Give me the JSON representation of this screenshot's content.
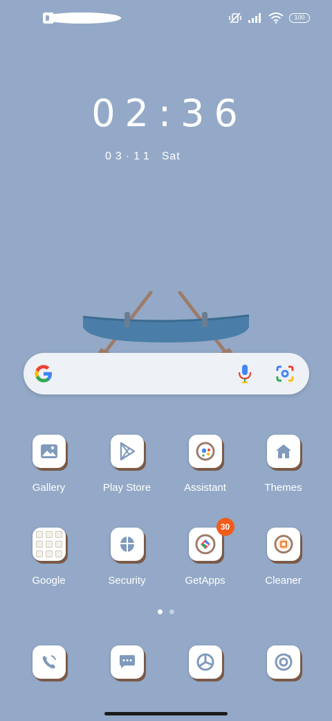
{
  "status_bar": {
    "left_icons": [
      "app-notification-icon",
      "square-notification-icon",
      "app-notification-icon",
      "more-dot-icon"
    ],
    "right_icons": [
      "vibrate-off-icon",
      "signal-icon",
      "wifi-icon",
      "battery-icon"
    ],
    "battery": "100"
  },
  "clock": {
    "time": "02:36",
    "date": "03·11",
    "weekday": "Sat"
  },
  "search": {
    "icons": [
      "google-g-icon",
      "microphone-icon",
      "google-lens-icon"
    ]
  },
  "apps": [
    {
      "label": "Gallery",
      "icon": "gallery-icon"
    },
    {
      "label": "Play Store",
      "icon": "play-store-icon"
    },
    {
      "label": "Assistant",
      "icon": "assistant-icon"
    },
    {
      "label": "Themes",
      "icon": "themes-icon"
    },
    {
      "label": "Google",
      "icon": "folder-icon"
    },
    {
      "label": "Security",
      "icon": "security-icon"
    },
    {
      "label": "GetApps",
      "icon": "getapps-icon",
      "badge": "30"
    },
    {
      "label": "Cleaner",
      "icon": "cleaner-icon"
    }
  ],
  "dock": [
    {
      "icon": "phone-icon"
    },
    {
      "icon": "messages-icon"
    },
    {
      "icon": "browser-icon"
    },
    {
      "icon": "camera-icon"
    }
  ],
  "pager": {
    "pages": 2,
    "active": 1
  },
  "colors": {
    "wallpaper": "#93a9c7",
    "icon_shadow": "#7a5a48",
    "badge": "#f25c1b",
    "canoe": "#4a7ea8"
  }
}
